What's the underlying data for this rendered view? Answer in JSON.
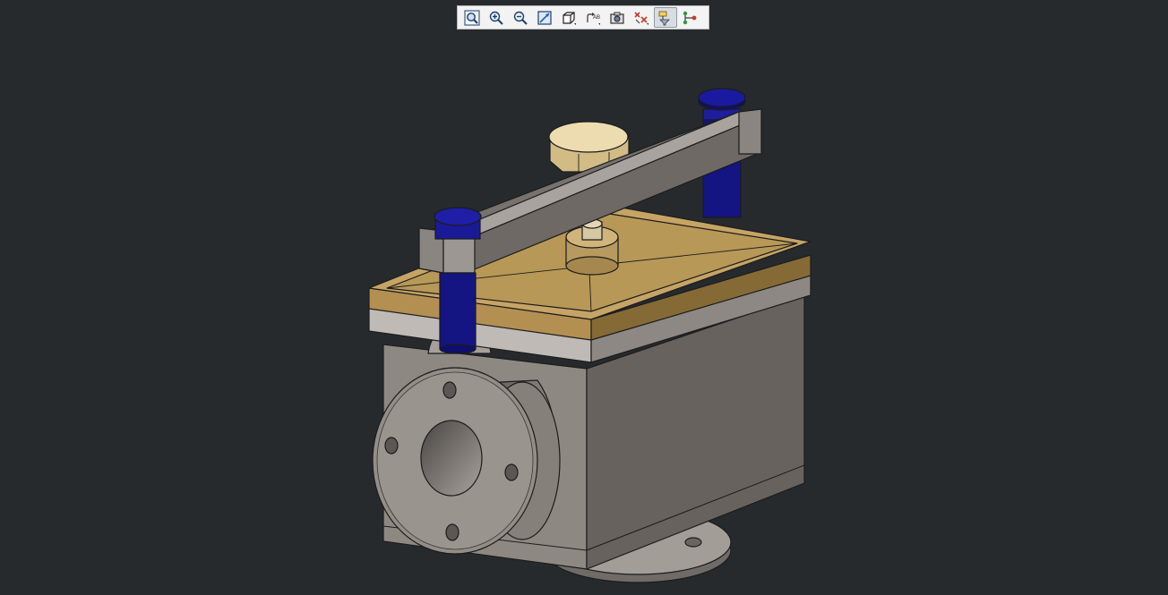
{
  "viewport": {
    "background": "#272a2d",
    "model": "3d-valve-assembly"
  },
  "toolbar": {
    "buttons": [
      {
        "name": "zoom-fit-button",
        "icon": "magnifier-fit-icon"
      },
      {
        "name": "zoom-in-button",
        "icon": "magnifier-plus-icon"
      },
      {
        "name": "zoom-out-button",
        "icon": "magnifier-minus-icon"
      },
      {
        "name": "zoom-area-button",
        "icon": "zoom-area-icon"
      },
      {
        "name": "view-orientation-button",
        "icon": "cube-icon"
      },
      {
        "name": "view-label-button",
        "icon": "rotate-ab-icon",
        "label": "AB"
      },
      {
        "name": "capture-button",
        "icon": "camera-icon"
      },
      {
        "name": "section-view-button",
        "icon": "cross-section-icon"
      },
      {
        "name": "tree-filter-button",
        "icon": "tree-filter-icon",
        "active": true
      },
      {
        "name": "branch-button",
        "icon": "branch-icon"
      }
    ]
  },
  "colors": {
    "background": "#272a2d",
    "bronze": "#c4a56a",
    "steel": "#8a8580",
    "bolt": "#1a1a8c",
    "nut": "#e6d2a0"
  }
}
